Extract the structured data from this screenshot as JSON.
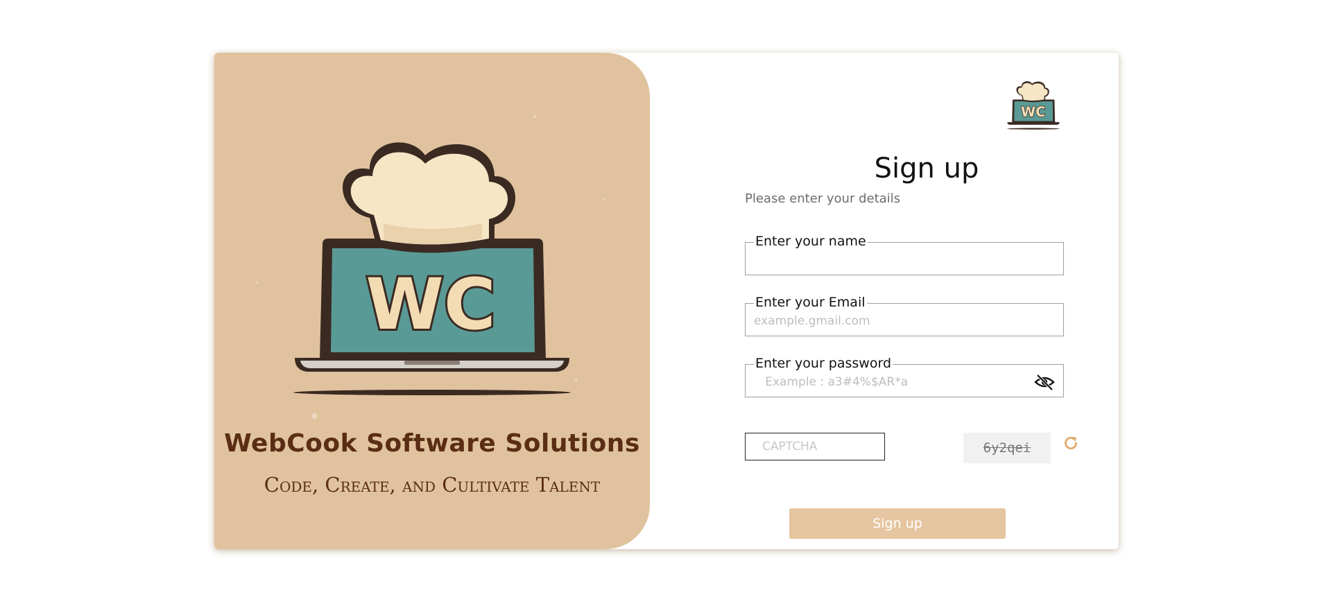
{
  "brand": {
    "name": "WebCook Software Solutions",
    "tagline": "Code, Create, and Cultivate Talent",
    "logo_text": "WC"
  },
  "form": {
    "title": "Sign up",
    "subtitle": "Please enter your details",
    "name_field": {
      "label": "Enter your name",
      "value": "",
      "placeholder": ""
    },
    "email_field": {
      "label": "Enter your Email",
      "value": "",
      "placeholder": "example.gmail.com"
    },
    "password_field": {
      "label": "Enter your password",
      "value": "",
      "placeholder": "   Example : a3#4%$AR*a"
    },
    "captcha": {
      "placeholder": "CAPTCHA",
      "value": "",
      "code": "6y2qei"
    },
    "submit_label": "Sign up"
  },
  "icons": {
    "password_toggle": "eye-slash-icon",
    "captcha_refresh": "refresh-icon"
  },
  "colors": {
    "brand_panel": "#e0c39e",
    "brand_text": "#5a2d14",
    "button": "#e6c6a0",
    "refresh": "#e2a86c",
    "screen_teal": "#5a9a96"
  }
}
